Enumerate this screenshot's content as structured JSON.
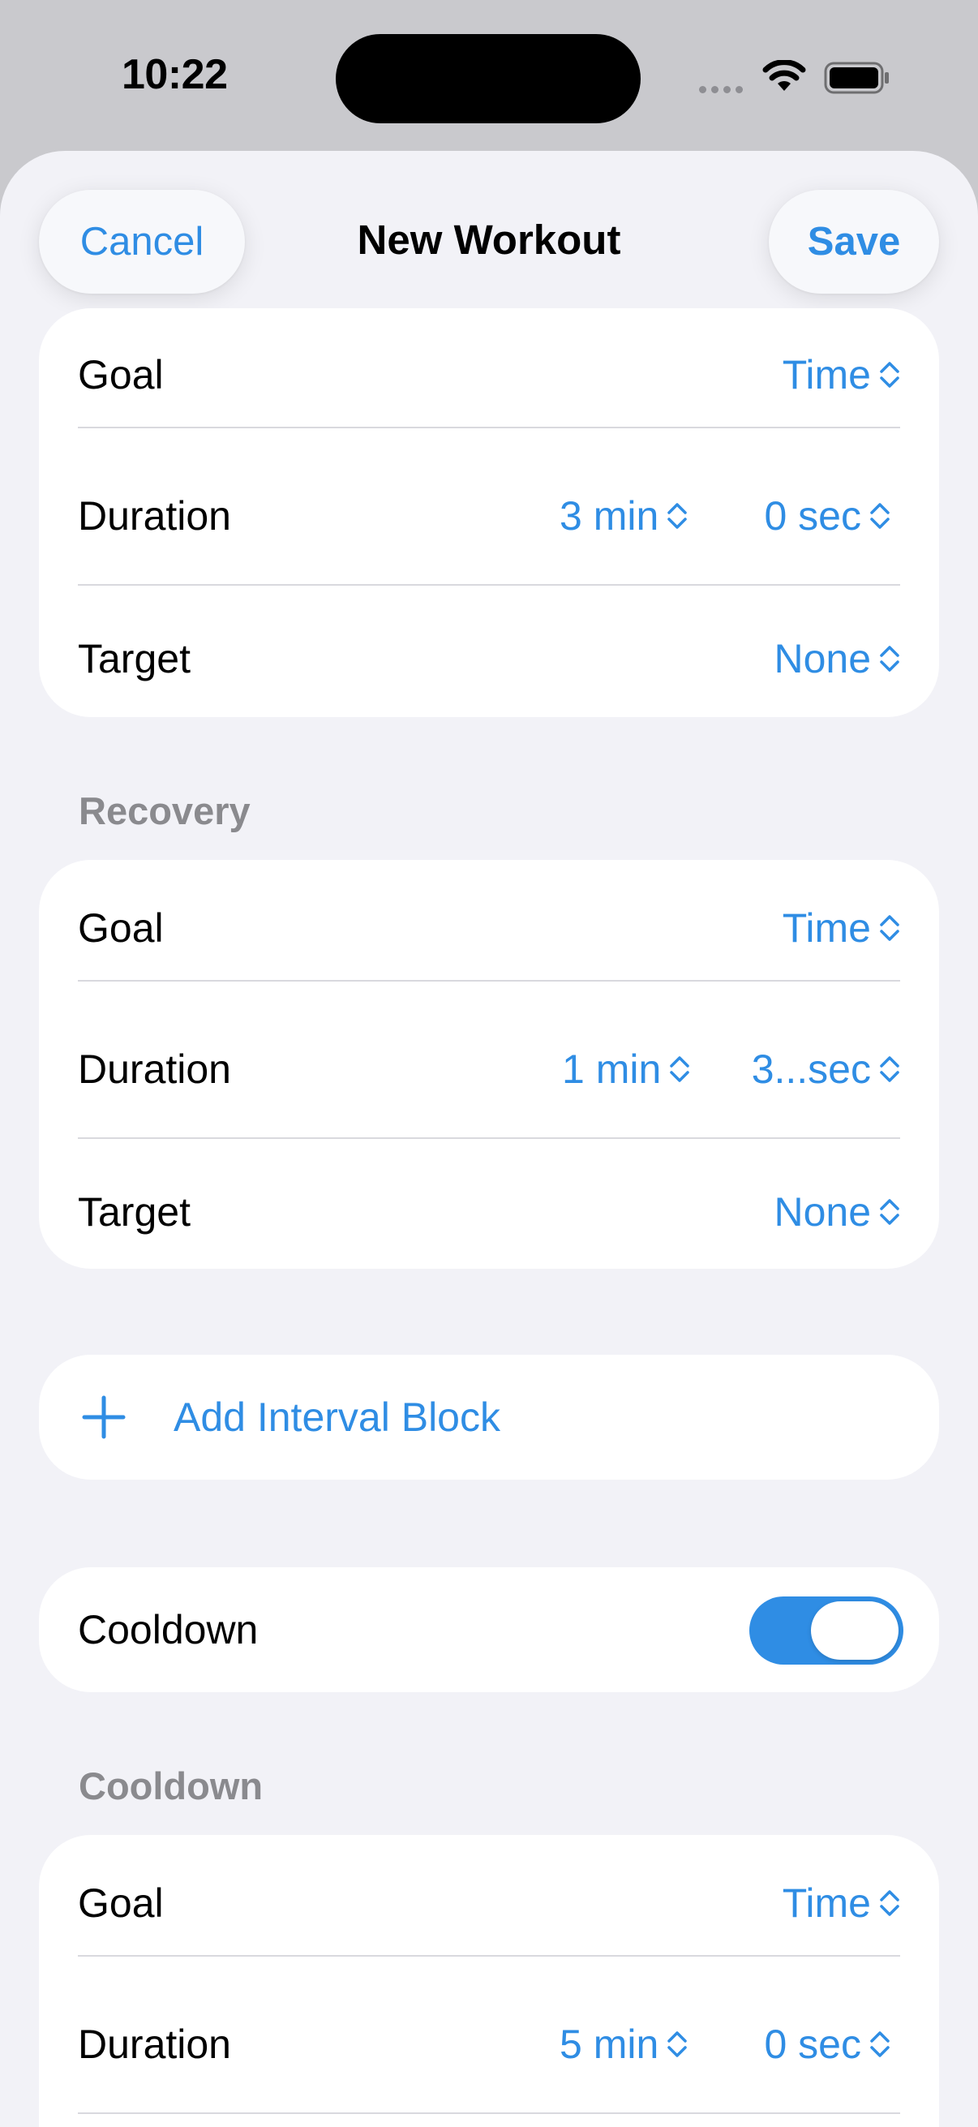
{
  "status_bar": {
    "time": "10:22"
  },
  "nav": {
    "cancel_label": "Cancel",
    "title": "New Workout",
    "save_label": "Save"
  },
  "work_block": {
    "goal": {
      "label": "Goal",
      "value": "Time"
    },
    "duration": {
      "label": "Duration",
      "minutes": "3 min",
      "seconds": "0 sec"
    },
    "target": {
      "label": "Target",
      "value": "None"
    }
  },
  "recovery": {
    "header": "Recovery",
    "goal": {
      "label": "Goal",
      "value": "Time"
    },
    "duration": {
      "label": "Duration",
      "minutes": "1 min",
      "seconds": "3...sec"
    },
    "target": {
      "label": "Target",
      "value": "None"
    }
  },
  "add_interval": {
    "label": "Add Interval Block"
  },
  "cooldown_toggle": {
    "label": "Cooldown",
    "on": true
  },
  "cooldown": {
    "header": "Cooldown",
    "goal": {
      "label": "Goal",
      "value": "Time"
    },
    "duration": {
      "label": "Duration",
      "minutes": "5 min",
      "seconds": "0 sec"
    }
  },
  "colors": {
    "accent": "#2f8de4",
    "background": "#f2f2f7",
    "card": "#ffffff",
    "section_header": "#8a8a8e"
  },
  "icons": [
    "wifi-icon",
    "battery-icon",
    "chevron-up-down-icon",
    "plus-icon"
  ]
}
